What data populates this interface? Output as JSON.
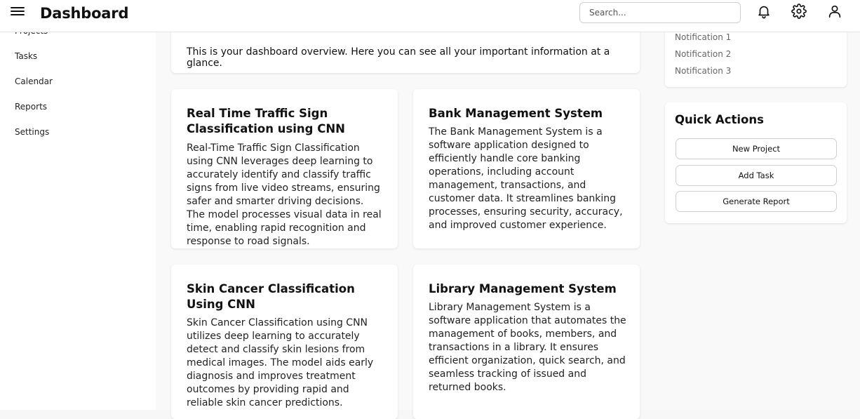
{
  "header": {
    "title": "Dashboard",
    "search_placeholder": "Search...",
    "icons": [
      "menu-icon",
      "bell-icon",
      "gear-icon",
      "user-icon"
    ]
  },
  "sidebar": {
    "items": [
      {
        "label": "Projects"
      },
      {
        "label": "Tasks"
      },
      {
        "label": "Calendar"
      },
      {
        "label": "Reports"
      },
      {
        "label": "Settings"
      }
    ]
  },
  "welcome": {
    "text": "This is your dashboard overview. Here you can see all your important information at a glance."
  },
  "projects": [
    {
      "title": "Real Time Traffic Sign Classification using CNN",
      "description": "Real-Time Traffic Sign Classification using CNN leverages deep learning to accurately identify and classify traffic signs from live video streams, ensuring safer and smarter driving decisions. The model processes visual data in real time, enabling rapid recognition and response to road signals."
    },
    {
      "title": "Bank Management System",
      "description": "The Bank Management System is a software application designed to efficiently handle core banking operations, including account management, transactions, and customer data. It streamlines banking processes, ensuring security, accuracy, and improved customer experience."
    },
    {
      "title": "Skin Cancer Classification Using CNN",
      "description": "Skin Cancer Classification using CNN utilizes deep learning to accurately detect and classify skin lesions from medical images. The model aids early diagnosis and improves treatment outcomes by providing rapid and reliable skin cancer predictions."
    },
    {
      "title": "Library Management System",
      "description": "Library Management System is a software application that automates the management of books, members, and transactions in a library. It ensures efficient organization, quick search, and seamless tracking of issued and returned books."
    }
  ],
  "notifications": {
    "items": [
      "Notification 1",
      "Notification 2",
      "Notification 3"
    ]
  },
  "quick_actions": {
    "title": "Quick Actions",
    "buttons": [
      "New Project",
      "Add Task",
      "Generate Report"
    ]
  }
}
